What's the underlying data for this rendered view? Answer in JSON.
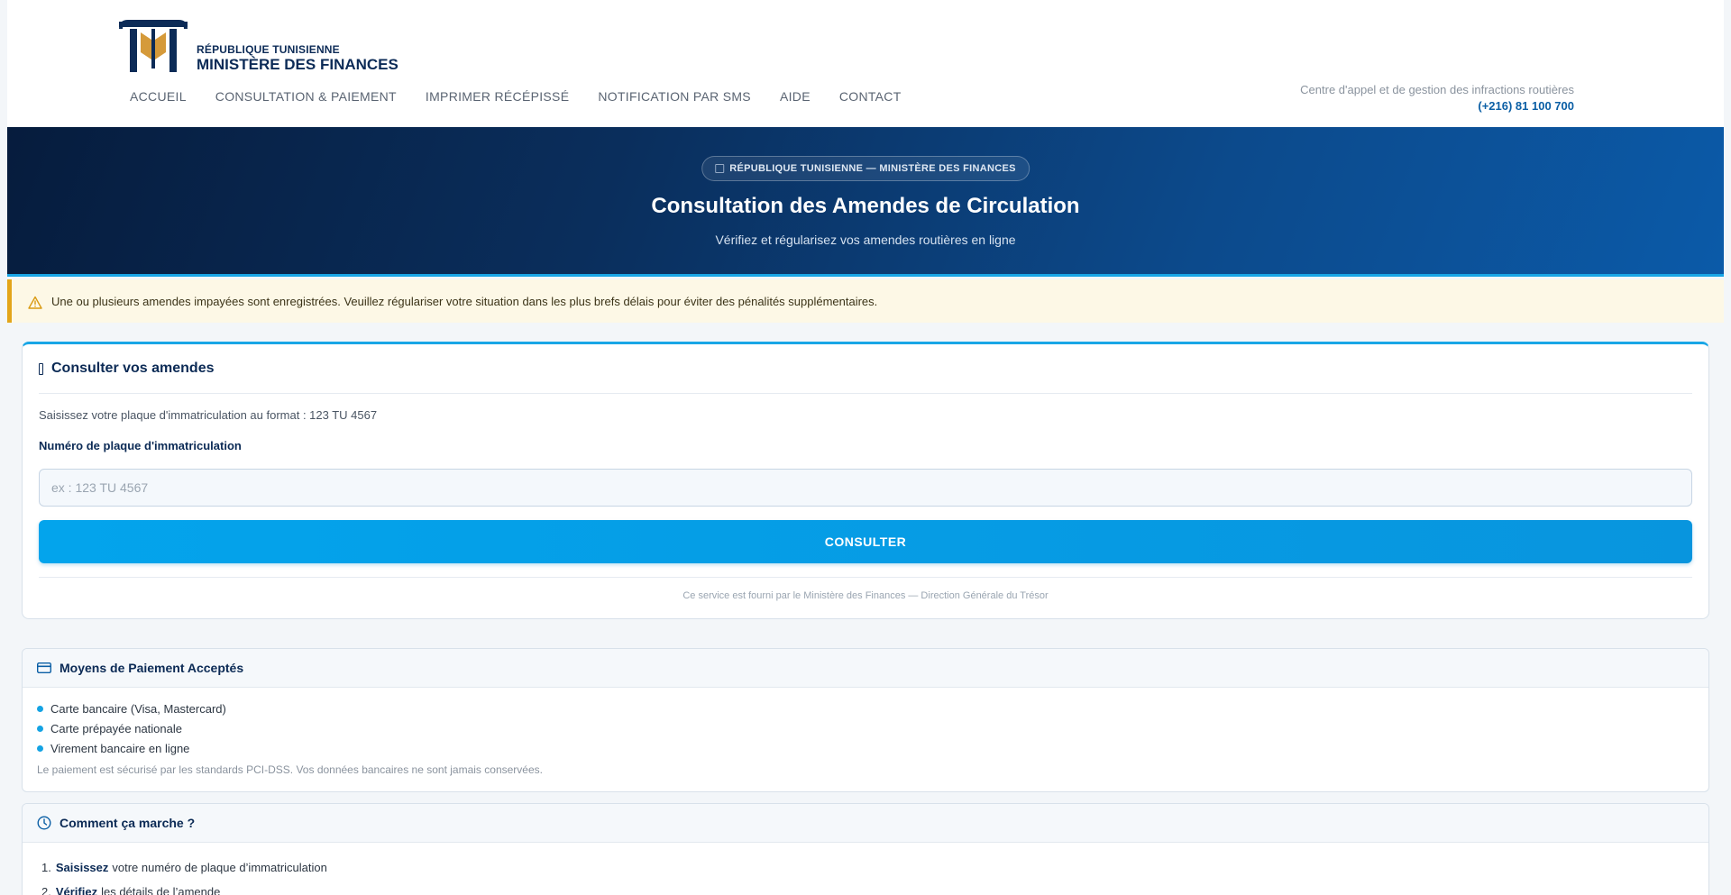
{
  "header": {
    "logo_line1": "RÉPUBLIQUE TUNISIENNE",
    "logo_line2": "MINISTÈRE DES FINANCES",
    "nav": [
      {
        "label": "ACCUEIL"
      },
      {
        "label": "CONSULTATION & PAIEMENT"
      },
      {
        "label": "IMPRIMER RÉCÉPISSÉ"
      },
      {
        "label": "NOTIFICATION PAR SMS"
      },
      {
        "label": "AIDE"
      },
      {
        "label": "CONTACT"
      }
    ],
    "callcenter_label": "Centre d'appel et de gestion des infractions routières",
    "callcenter_phone": "(+216) 81 100 700"
  },
  "hero": {
    "badge": "RÉPUBLIQUE TUNISIENNE — MINISTÈRE DES FINANCES",
    "title": "Consultation des Amendes de Circulation",
    "subtitle": "Vérifiez et régularisez vos amendes routières en ligne"
  },
  "alert": {
    "text": "Une ou plusieurs amendes impayées sont enregistrées. Veuillez régulariser votre situation dans les plus brefs délais pour éviter des pénalités supplémentaires."
  },
  "form": {
    "title": "Consulter vos amendes",
    "hint": "Saisissez votre plaque d'immatriculation au format : 123 TU 4567",
    "field_label": "Numéro de plaque d'immatriculation",
    "plate_value": "",
    "plate_placeholder": "ex : 123 TU 4567",
    "button_label": "CONSULTER",
    "footer": "Ce service est fourni par le Ministère des Finances — Direction Générale du Trésor"
  },
  "payment": {
    "title": "Moyens de Paiement Acceptés",
    "methods": [
      {
        "label": "Carte bancaire (Visa, Mastercard)"
      },
      {
        "label": "Carte prépayée nationale"
      },
      {
        "label": "Virement bancaire en ligne"
      }
    ],
    "note": "Le paiement est sécurisé par les standards PCI-DSS. Vos données bancaires ne sont jamais conservées."
  },
  "how": {
    "title": "Comment ça marche ?",
    "steps": [
      {
        "num": "1.",
        "bold": "Saisissez",
        "rest": "votre numéro de plaque d’immatriculation"
      },
      {
        "num": "2.",
        "bold": "Vérifiez",
        "rest": "les détails de l’amende"
      }
    ]
  },
  "colors": {
    "brand_navy": "#0b2a55",
    "accent_blue": "#03a4ec",
    "alert_amber": "#e3a51a",
    "phone_link": "#0b5fa5"
  },
  "icons": {
    "logo": "ministry-pillar-logo",
    "alert": "warning-triangle-icon",
    "form": "search-icon",
    "payment": "credit-card-icon",
    "how": "clock-icon"
  }
}
